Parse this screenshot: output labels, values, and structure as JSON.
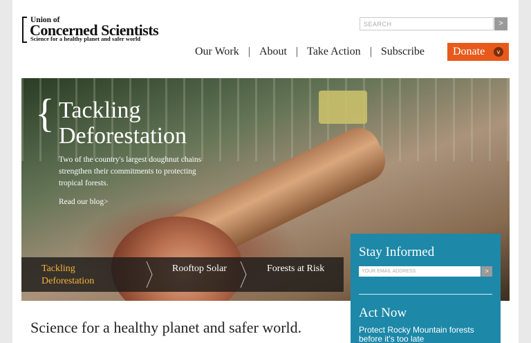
{
  "header": {
    "logo": {
      "line1": "Union of",
      "line2": "Concerned Scientists",
      "line3": "Science for a healthy planet and safer world"
    },
    "search": {
      "placeholder": "SEARCH",
      "submit_label": ">"
    },
    "nav": {
      "items": [
        "Our Work",
        "About",
        "Take Action",
        "Subscribe"
      ],
      "separator": "|",
      "donate_label": "Donate",
      "donate_icon": "v"
    }
  },
  "hero": {
    "brace": "{",
    "title": "Tackling Deforestation",
    "blurb": "Two of the country's largest doughnut chains strengthen their commitments to protecting tropical forests.",
    "link": "Read our blog>",
    "tabs": [
      {
        "label": "Tackling Deforestation",
        "active": true
      },
      {
        "label": "Rooftop Solar",
        "active": false
      },
      {
        "label": "Forests at Risk",
        "active": false
      }
    ]
  },
  "sidebar": {
    "stay_title": "Stay Informed",
    "email_placeholder": "YOUR EMAIL ADDRESS",
    "email_submit": ">",
    "act_title": "Act Now",
    "act_link": "Protect Rocky Mountain forests before it's too late"
  },
  "tagline": "Science for a healthy planet and safer world.",
  "colors": {
    "accent_orange": "#e75a1c",
    "panel_blue": "#1d88a8",
    "active_tab": "#f6b23a"
  }
}
